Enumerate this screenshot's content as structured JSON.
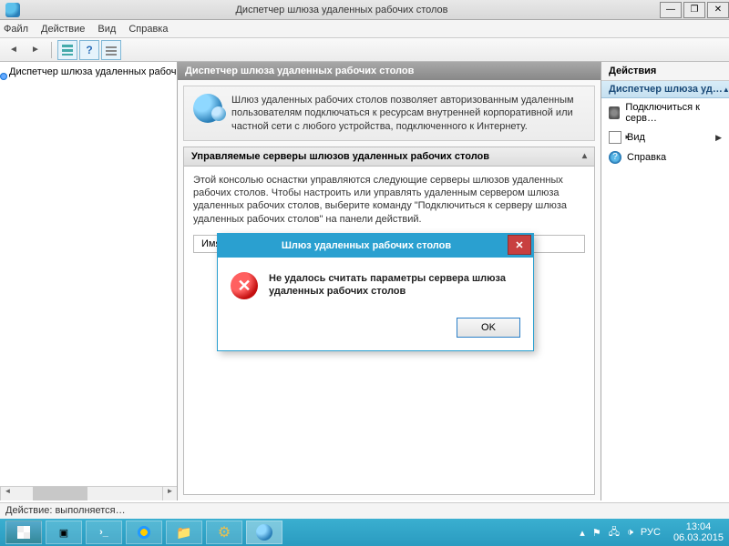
{
  "window": {
    "title": "Диспетчер шлюза удаленных рабочих столов"
  },
  "menu": {
    "file": "Файл",
    "action": "Действие",
    "view": "Вид",
    "help": "Справка"
  },
  "tree": {
    "root": "Диспетчер шлюза удаленных рабочих сто…"
  },
  "center": {
    "header": "Диспетчер шлюза удаленных рабочих столов",
    "description": "Шлюз удаленных рабочих столов позволяет авторизованным удаленным пользователям подключаться к ресурсам внутренней корпоративной или частной сети с любого устройства, подключенного к Интернету.",
    "managed_header": "Управляемые серверы шлюзов удаленных рабочих столов",
    "managed_desc": "Этой консолью оснастки управляются следующие серверы шлюзов удаленных рабочих столов. Чтобы настроить или управлять удаленным сервером шлюза удаленных рабочих столов, выберите команду \"Подключиться к серверу шлюза удаленных рабочих столов\" на панели действий.",
    "col_name": "Имя"
  },
  "actions": {
    "title": "Действия",
    "group": "Диспетчер шлюза уд…",
    "connect": "Подключиться к серв…",
    "view": "Вид",
    "help": "Справка"
  },
  "dialog": {
    "title": "Шлюз удаленных рабочих столов",
    "message": "Не удалось считать параметры сервера шлюза удаленных рабочих столов",
    "ok": "OK"
  },
  "status": {
    "text": "Действие: выполняется…"
  },
  "taskbar": {
    "lang": "РУС",
    "time": "13:04",
    "date": "06.03.2015"
  }
}
